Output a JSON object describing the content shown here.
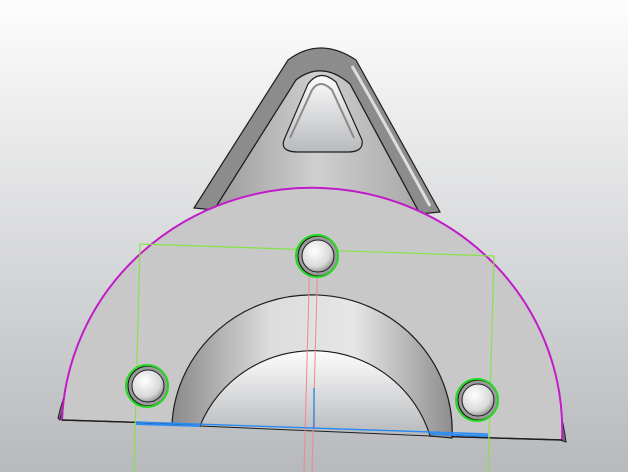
{
  "viewport": {
    "background_top": "#fdfdfd",
    "background_bottom": "#b7b9bc"
  },
  "part": {
    "face_color": "#c8c8c8",
    "face_light": "#e4e4e4",
    "face_dark": "#7e7e7e",
    "edge_color": "#1e1e1e",
    "selected_edge_color": "#c21bc9"
  },
  "overlays": {
    "sketch_frame_color": "#86e24a",
    "hole_highlight_color": "#22d81e",
    "axis_red_color": "#f08a8a",
    "axis_blue_color": "#2a8bf2"
  },
  "features": {
    "mounting_holes": 3,
    "lug_with_triangular_cutout": true,
    "semicircular_arch_cutout": true
  }
}
